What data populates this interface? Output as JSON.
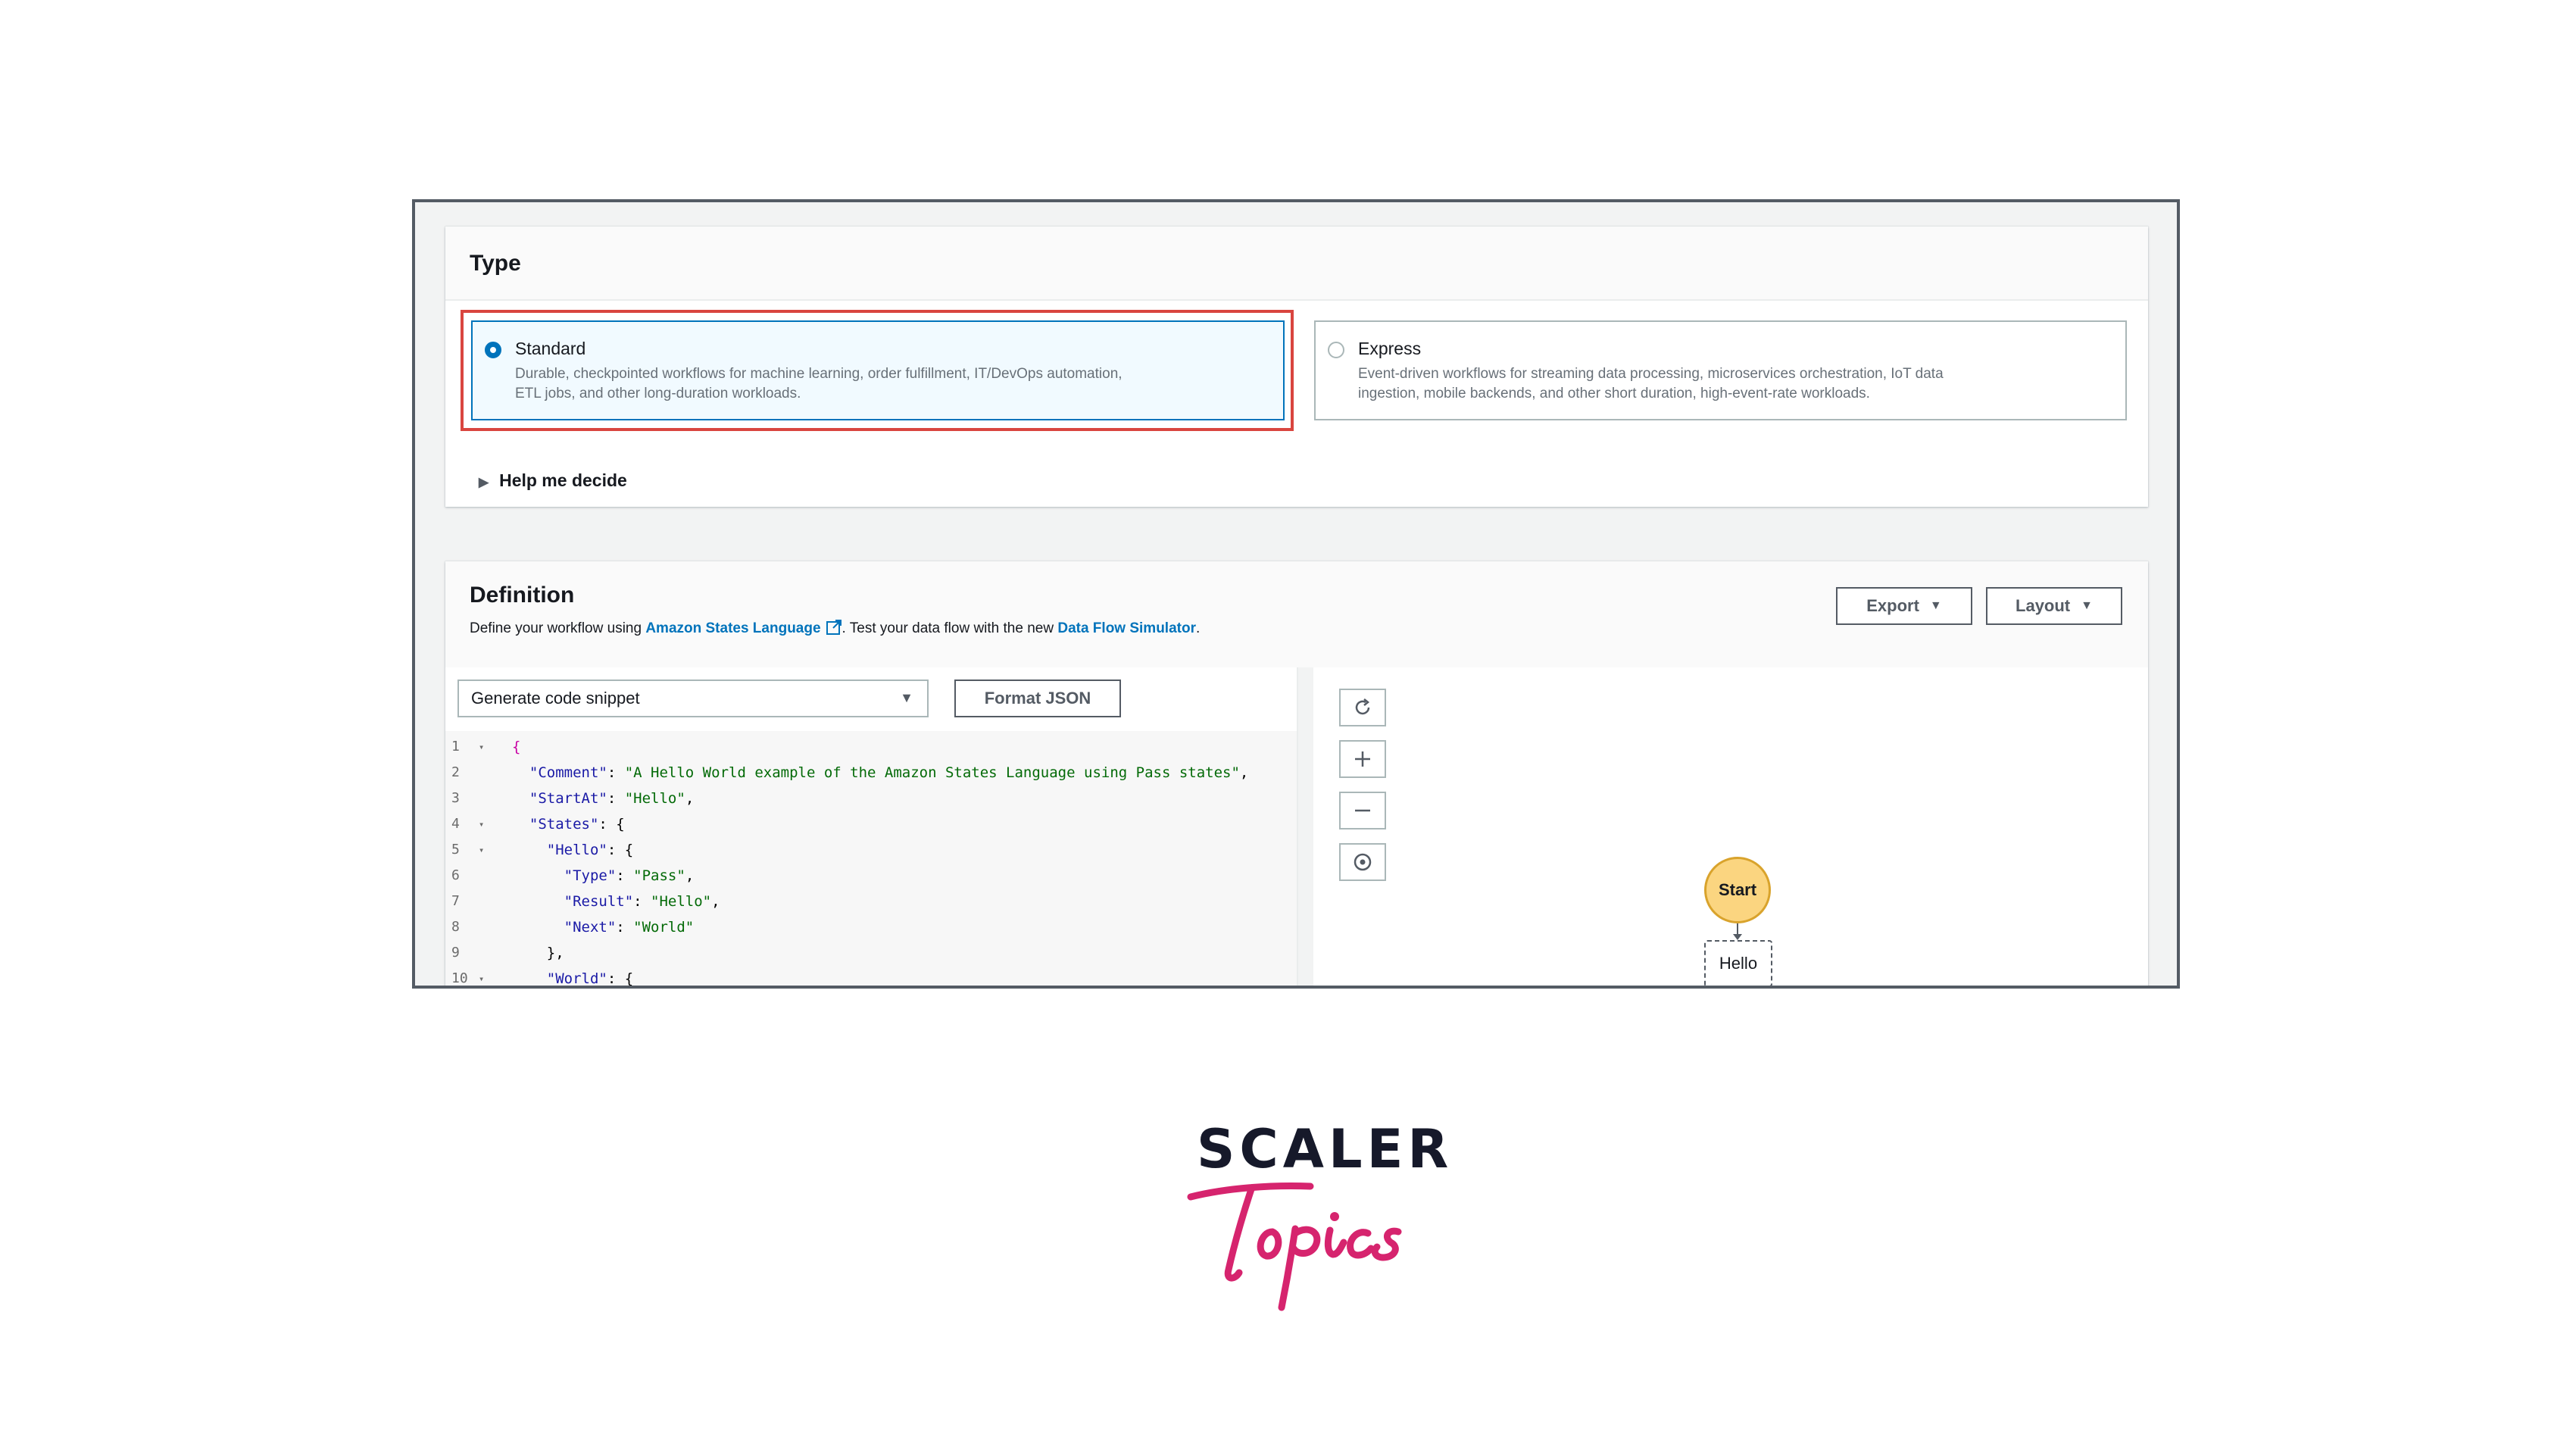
{
  "type_section": {
    "title": "Type",
    "options": [
      {
        "label": "Standard",
        "description_line1": "Durable, checkpointed workflows for machine learning, order fulfillment, IT/DevOps automation,",
        "description_line2": "ETL jobs, and other long-duration workloads.",
        "selected": true
      },
      {
        "label": "Express",
        "description_line1": "Event-driven workflows for streaming data processing, microservices orchestration, IoT data",
        "description_line2": "ingestion, mobile backends, and other short duration, high-event-rate workloads.",
        "selected": false
      }
    ],
    "help_label": "Help me decide"
  },
  "definition": {
    "title": "Definition",
    "desc_prefix": "Define your workflow using ",
    "link_asl": "Amazon States Language",
    "desc_middle": ". Test your data flow with the new ",
    "link_simulator": "Data Flow Simulator",
    "desc_suffix": ".",
    "export_label": "Export",
    "layout_label": "Layout",
    "snippet_select": "Generate code snippet",
    "format_label": "Format JSON",
    "code_lines": [
      {
        "n": "1",
        "fold": true,
        "text": "{"
      },
      {
        "n": "2",
        "fold": false,
        "text": "  \"Comment\": \"A Hello World example of the Amazon States Language using Pass states\","
      },
      {
        "n": "3",
        "fold": false,
        "text": "  \"StartAt\": \"Hello\","
      },
      {
        "n": "4",
        "fold": true,
        "text": "  \"States\": {"
      },
      {
        "n": "5",
        "fold": true,
        "text": "    \"Hello\": {"
      },
      {
        "n": "6",
        "fold": false,
        "text": "      \"Type\": \"Pass\","
      },
      {
        "n": "7",
        "fold": false,
        "text": "      \"Result\": \"Hello\","
      },
      {
        "n": "8",
        "fold": false,
        "text": "      \"Next\": \"World\""
      },
      {
        "n": "9",
        "fold": false,
        "text": "    },"
      },
      {
        "n": "10",
        "fold": true,
        "text": "    \"World\": {"
      }
    ]
  },
  "graph": {
    "controls": [
      "refresh-icon",
      "zoom-in-icon",
      "zoom-out-icon",
      "center-icon"
    ],
    "start_label": "Start",
    "hello_label": "Hello"
  },
  "brand": {
    "word": "SCALER",
    "script": "Topics",
    "accent": "#d6246e"
  },
  "colors": {
    "selection_border": "#d9453f",
    "selected_tile": "#0073bb",
    "start_node": "#fbd580"
  }
}
